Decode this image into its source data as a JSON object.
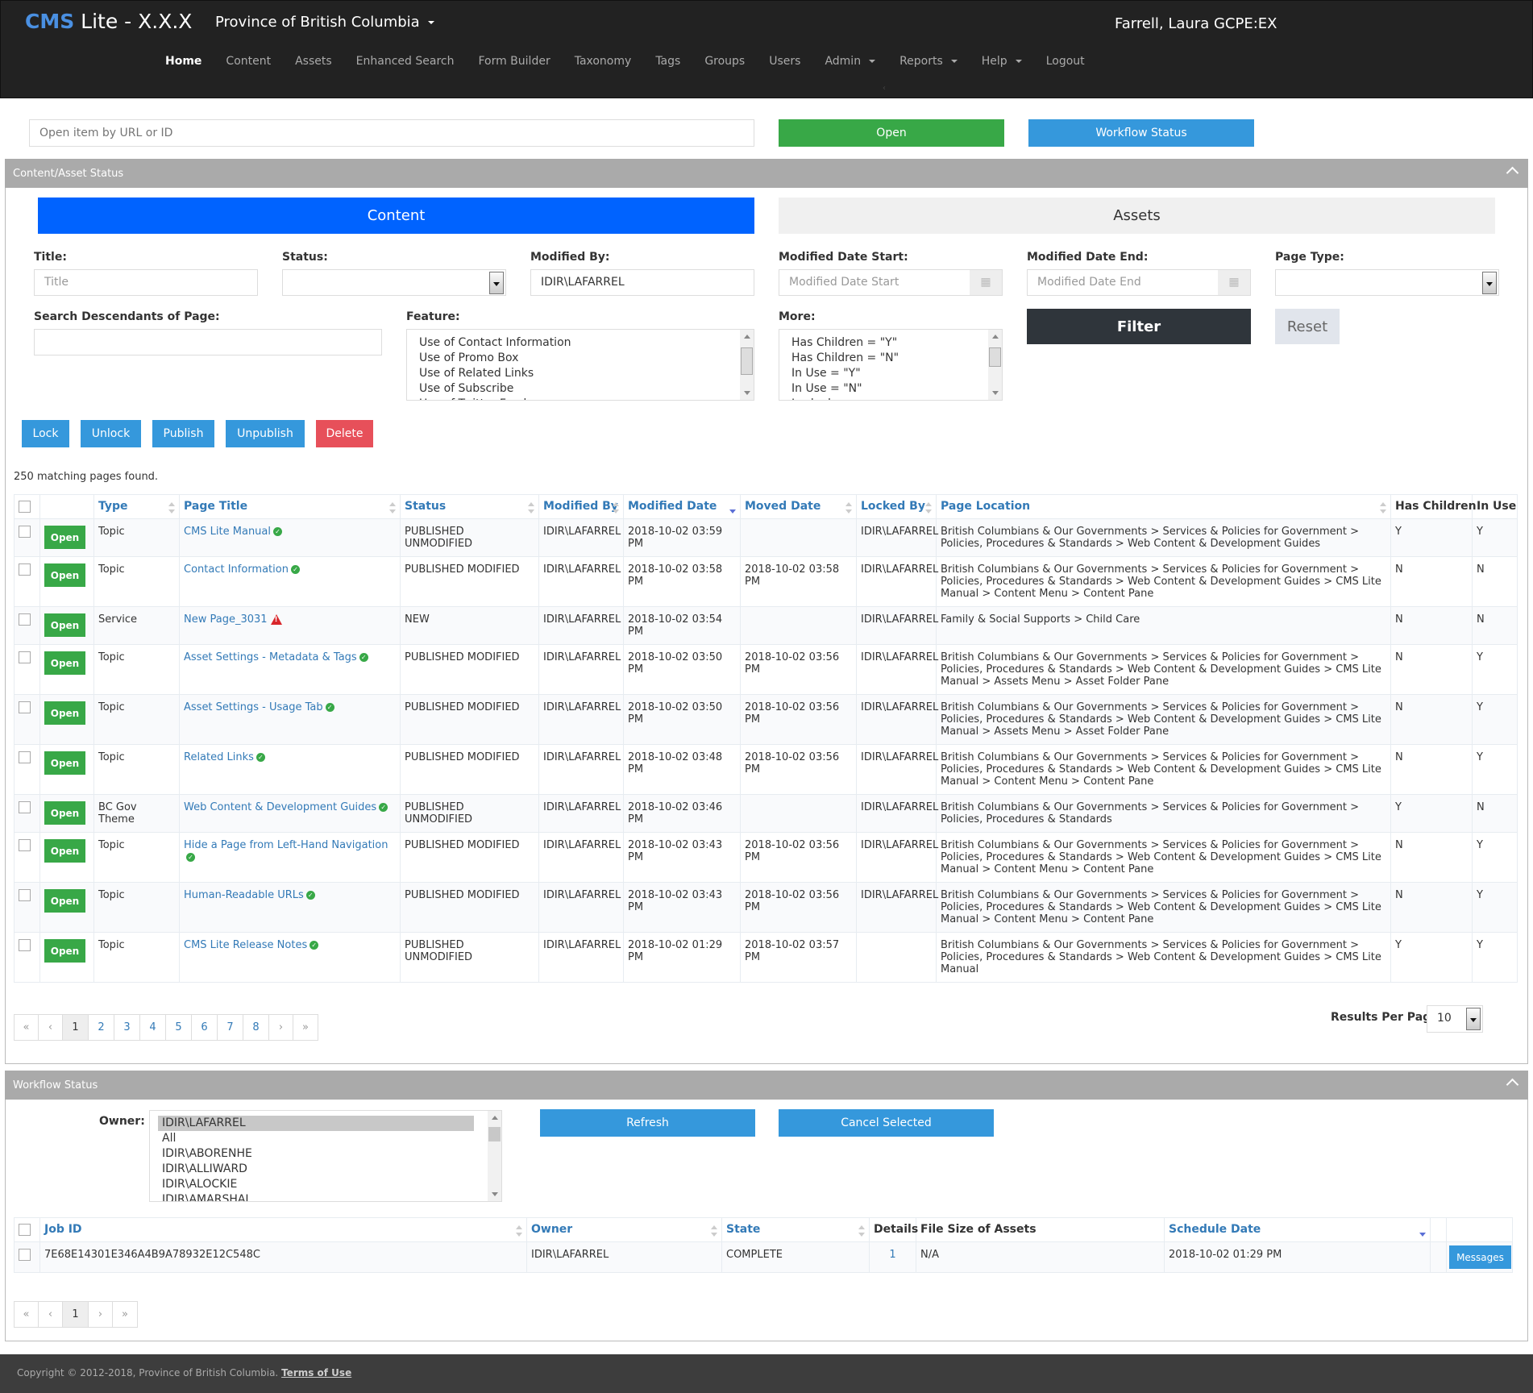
{
  "header": {
    "brand_strong": "CMS",
    "brand_rest": " Lite - X.X.X",
    "org": "Province of British Columbia",
    "user": "Farrell, Laura GCPE:EX",
    "nav": [
      {
        "label": "Home",
        "active": true
      },
      {
        "label": "Content"
      },
      {
        "label": "Assets"
      },
      {
        "label": "Enhanced Search"
      },
      {
        "label": "Form Builder"
      },
      {
        "label": "Taxonomy"
      },
      {
        "label": "Tags"
      },
      {
        "label": "Groups"
      },
      {
        "label": "Users"
      },
      {
        "label": "Admin",
        "dropdown": true
      },
      {
        "label": "Reports",
        "dropdown": true
      },
      {
        "label": "Help",
        "dropdown": true
      },
      {
        "label": "Logout"
      }
    ]
  },
  "open_row": {
    "placeholder": "Open item by URL or ID",
    "open_label": "Open",
    "workflow_label": "Workflow Status"
  },
  "content_panel": {
    "title": "Content/Asset Status",
    "tabs": {
      "content": "Content",
      "assets": "Assets"
    },
    "filters": {
      "title_label": "Title:",
      "title_placeholder": "Title",
      "status_label": "Status:",
      "status_value": "",
      "modified_by_label": "Modified By:",
      "modified_by_value": "IDIR\\LAFARREL",
      "date_start_label": "Modified Date Start:",
      "date_start_placeholder": "Modified Date Start",
      "date_end_label": "Modified Date End:",
      "date_end_placeholder": "Modified Date End",
      "page_type_label": "Page Type:",
      "page_type_value": "",
      "descendants_label": "Search Descendants of Page:",
      "descendants_value": "",
      "feature_label": "Feature:",
      "feature_options": [
        "Use of Contact Information",
        "Use of Promo Box",
        "Use of Related Links",
        "Use of Subscribe",
        "Use of Twitter Feed"
      ],
      "more_label": "More:",
      "more_options": [
        "Has Children = \"Y\"",
        "Has Children = \"N\"",
        "In Use = \"Y\"",
        "In Use = \"N\"",
        "Locked"
      ],
      "filter_label": "Filter",
      "reset_label": "Reset"
    },
    "actions": {
      "lock": "Lock",
      "unlock": "Unlock",
      "publish": "Publish",
      "unpublish": "Unpublish",
      "delete": "Delete"
    },
    "match_count": "250 matching pages found.",
    "table": {
      "columns": [
        "Type",
        "Page Title",
        "Status",
        "Modified By",
        "Modified Date",
        "Moved Date",
        "Locked By",
        "Page Location",
        "Has Children",
        "In Use"
      ],
      "open_label": "Open",
      "rows": [
        {
          "type": "Topic",
          "title": "CMS Lite Manual",
          "icon": "check",
          "status": "PUBLISHED UNMODIFIED",
          "modified_by": "IDIR\\LAFARREL",
          "modified_date": "2018-10-02 03:59 PM",
          "moved_date": "",
          "locked_by": "IDIR\\LAFARREL",
          "location": "British Columbians & Our Governments > Services & Policies for Government > Policies, Procedures & Standards > Web Content & Development Guides",
          "has_children": "Y",
          "in_use": "Y"
        },
        {
          "type": "Topic",
          "title": "Contact Information",
          "icon": "check",
          "status": "PUBLISHED MODIFIED",
          "modified_by": "IDIR\\LAFARREL",
          "modified_date": "2018-10-02 03:58 PM",
          "moved_date": "2018-10-02 03:58 PM",
          "locked_by": "IDIR\\LAFARREL",
          "location": "British Columbians & Our Governments > Services & Policies for Government > Policies, Procedures & Standards > Web Content & Development Guides > CMS Lite Manual > Content Menu > Content Pane",
          "has_children": "N",
          "in_use": "N"
        },
        {
          "type": "Service",
          "title": "New Page_3031",
          "icon": "warning",
          "status": "NEW",
          "modified_by": "IDIR\\LAFARREL",
          "modified_date": "2018-10-02 03:54 PM",
          "moved_date": "",
          "locked_by": "IDIR\\LAFARREL",
          "location": "Family & Social Supports > Child Care",
          "has_children": "N",
          "in_use": "N"
        },
        {
          "type": "Topic",
          "title": "Asset Settings - Metadata & Tags",
          "icon": "check",
          "status": "PUBLISHED MODIFIED",
          "modified_by": "IDIR\\LAFARREL",
          "modified_date": "2018-10-02 03:50 PM",
          "moved_date": "2018-10-02 03:56 PM",
          "locked_by": "IDIR\\LAFARREL",
          "location": "British Columbians & Our Governments > Services & Policies for Government > Policies, Procedures & Standards > Web Content & Development Guides > CMS Lite Manual > Assets Menu > Asset Folder Pane",
          "has_children": "N",
          "in_use": "Y"
        },
        {
          "type": "Topic",
          "title": "Asset Settings - Usage Tab",
          "icon": "check",
          "status": "PUBLISHED MODIFIED",
          "modified_by": "IDIR\\LAFARREL",
          "modified_date": "2018-10-02 03:50 PM",
          "moved_date": "2018-10-02 03:56 PM",
          "locked_by": "IDIR\\LAFARREL",
          "location": "British Columbians & Our Governments > Services & Policies for Government > Policies, Procedures & Standards > Web Content & Development Guides > CMS Lite Manual > Assets Menu > Asset Folder Pane",
          "has_children": "N",
          "in_use": "Y"
        },
        {
          "type": "Topic",
          "title": "Related Links",
          "icon": "check",
          "status": "PUBLISHED MODIFIED",
          "modified_by": "IDIR\\LAFARREL",
          "modified_date": "2018-10-02 03:48 PM",
          "moved_date": "2018-10-02 03:56 PM",
          "locked_by": "IDIR\\LAFARREL",
          "location": "British Columbians & Our Governments > Services & Policies for Government > Policies, Procedures & Standards > Web Content & Development Guides > CMS Lite Manual > Content Menu > Content Pane",
          "has_children": "N",
          "in_use": "Y"
        },
        {
          "type": "BC Gov Theme",
          "title": "Web Content & Development Guides",
          "icon": "check",
          "status": "PUBLISHED UNMODIFIED",
          "modified_by": "IDIR\\LAFARREL",
          "modified_date": "2018-10-02 03:46 PM",
          "moved_date": "",
          "locked_by": "IDIR\\LAFARREL",
          "location": "British Columbians & Our Governments > Services & Policies for Government > Policies, Procedures & Standards",
          "has_children": "Y",
          "in_use": "N"
        },
        {
          "type": "Topic",
          "title": "Hide a Page from Left-Hand Navigation",
          "icon": "check",
          "status": "PUBLISHED MODIFIED",
          "modified_by": "IDIR\\LAFARREL",
          "modified_date": "2018-10-02 03:43 PM",
          "moved_date": "2018-10-02 03:56 PM",
          "locked_by": "IDIR\\LAFARREL",
          "location": "British Columbians & Our Governments > Services & Policies for Government > Policies, Procedures & Standards > Web Content & Development Guides > CMS Lite Manual > Content Menu > Content Pane",
          "has_children": "N",
          "in_use": "Y"
        },
        {
          "type": "Topic",
          "title": "Human-Readable URLs",
          "icon": "check",
          "status": "PUBLISHED MODIFIED",
          "modified_by": "IDIR\\LAFARREL",
          "modified_date": "2018-10-02 03:43 PM",
          "moved_date": "2018-10-02 03:56 PM",
          "locked_by": "IDIR\\LAFARREL",
          "location": "British Columbians & Our Governments > Services & Policies for Government > Policies, Procedures & Standards > Web Content & Development Guides > CMS Lite Manual > Content Menu > Content Pane",
          "has_children": "N",
          "in_use": "Y"
        },
        {
          "type": "Topic",
          "title": "CMS Lite Release Notes",
          "icon": "check",
          "status": "PUBLISHED UNMODIFIED",
          "modified_by": "IDIR\\LAFARREL",
          "modified_date": "2018-10-02 01:29 PM",
          "moved_date": "2018-10-02 03:57 PM",
          "locked_by": "",
          "location": "British Columbians & Our Governments > Services & Policies for Government > Policies, Procedures & Standards > Web Content & Development Guides > CMS Lite Manual",
          "has_children": "Y",
          "in_use": "Y"
        }
      ]
    },
    "pagination": {
      "pages": [
        "1",
        "2",
        "3",
        "4",
        "5",
        "6",
        "7",
        "8"
      ],
      "current": "1",
      "first": "«",
      "prev": "‹",
      "next": "›",
      "last": "»"
    },
    "results_per_page_label": "Results Per Page:",
    "results_per_page_value": "10"
  },
  "workflow_panel": {
    "title": "Workflow Status",
    "owner_label": "Owner:",
    "owner_options": [
      "IDIR\\LAFARREL",
      "All",
      "IDIR\\ABORENHE",
      "IDIR\\ALLIWARD",
      "IDIR\\ALOCKIE",
      "IDIR\\AMARSHAL"
    ],
    "owner_selected": "IDIR\\LAFARREL",
    "refresh_label": "Refresh",
    "cancel_label": "Cancel Selected",
    "table": {
      "columns": [
        "Job ID",
        "Owner",
        "State",
        "Details",
        "File Size of Assets",
        "Schedule Date"
      ],
      "messages_label": "Messages",
      "rows": [
        {
          "job_id": "7E68E14301E346A4B9A78932E12C548C",
          "owner": "IDIR\\LAFARREL",
          "state": "COMPLETE",
          "details": "1",
          "file_size": "N/A",
          "schedule_date": "2018-10-02 01:29 PM"
        }
      ]
    },
    "pagination": {
      "pages": [
        "1"
      ],
      "current": "1",
      "first": "«",
      "prev": "‹",
      "next": "›",
      "last": "»"
    }
  },
  "footer": {
    "copyright": "Copyright © 2012-2018, Province of British Columbia. ",
    "terms": "Terms of Use"
  },
  "colors": {
    "header_bg": "#222222",
    "content_tab": "#0063ff",
    "green": "#38a847",
    "blue": "#3598dc",
    "red": "#e7505a",
    "filter_dark": "#2f353b",
    "panel_head": "#aaaaaa",
    "link": "#337ab7"
  }
}
